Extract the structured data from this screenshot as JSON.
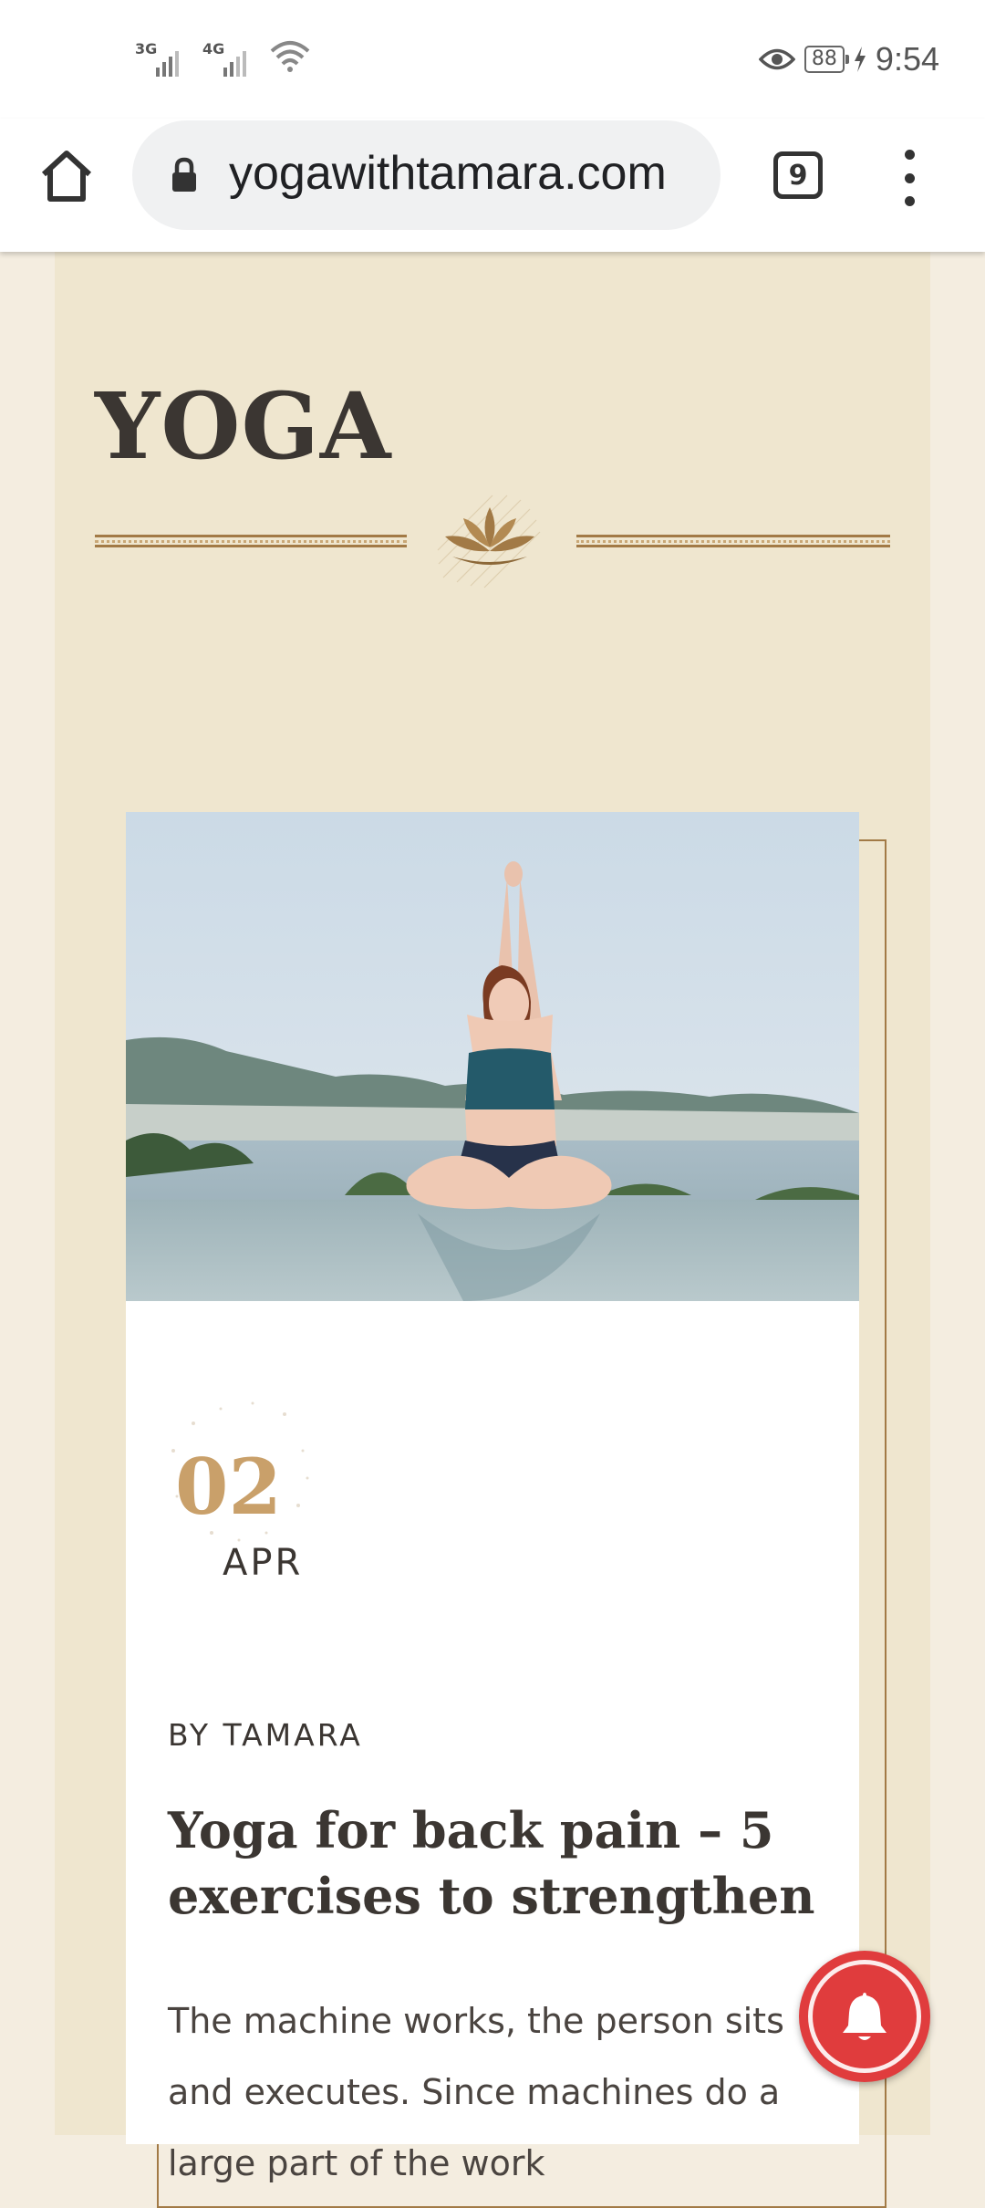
{
  "status_bar": {
    "network_1": "3G",
    "network_2": "4G",
    "battery": "88",
    "time": "9:54"
  },
  "browser": {
    "url": "yogawithtamara.com",
    "tab_count": "9"
  },
  "section": {
    "title": "YOGA"
  },
  "post": {
    "date_day": "02",
    "date_month": "APR",
    "byline": "BY TAMARA",
    "title": "Yoga for back pain – 5 exercises to strengthen",
    "excerpt": "The machine works, the person sits and executes. Since machines do a large part of the work"
  },
  "colors": {
    "accent_gold": "#c9a06a",
    "panel_bg": "#efe6cf",
    "page_bg": "#f4ede0",
    "notification_red": "#e03c3d"
  }
}
